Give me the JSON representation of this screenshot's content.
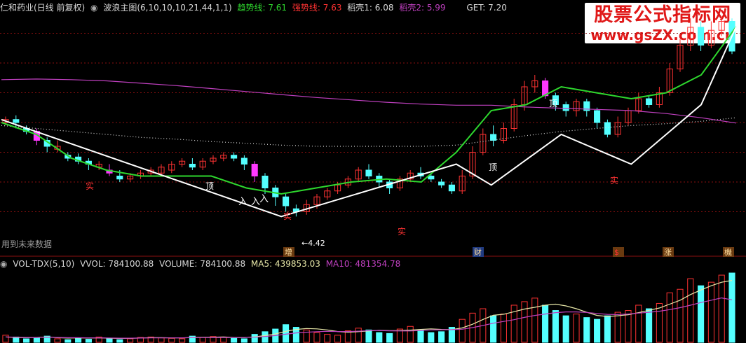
{
  "header": {
    "stock_title": "仁和药业(日线 前复权)",
    "indicator_title": "波浪主图(6,10,10,10,21,44,1,1)",
    "trend_line": "趋势线: 7.61",
    "strong_line": "强势线: 7.63",
    "rice_husk_1": "稻壳1: 6.08",
    "rice_husk_2": "稻壳2: 5.99",
    "get_value": "GET: 7.20"
  },
  "volume_header": {
    "indicator": "VOL-TDX(5,10)",
    "vvol": "VVOL: 784100.88",
    "volume": "VOLUME: 784100.88",
    "ma5": "MA5: 439853.03",
    "ma10": "MA10: 481354.78"
  },
  "watermark": {
    "title": "股票公式指标网",
    "url": "www.gsZX.com.cn"
  },
  "note": "用到未来数据",
  "annotations": {
    "ding": "顶",
    "shi": "实",
    "ru": "入",
    "low_price": "4.42"
  },
  "event_badges": [
    "增",
    "财",
    "$",
    "涨",
    "機"
  ],
  "colors": {
    "up": "#ff3232",
    "down": "#54ffff",
    "trend": "#2ed82e",
    "strong": "#ff3232",
    "husk1": "#d9d9d9",
    "husk2": "#c040c0",
    "wave": "#ffffff",
    "grid": "#8b1010",
    "ma5": "#e8e8a8",
    "ma10": "#c040c0",
    "highlight": "#ff38ff",
    "badge_bg": "#6a3a10",
    "badge_blue_bg": "#203a80"
  },
  "chart_data": [
    {
      "type": "candlestick",
      "title": "波浪主图(6,10,10,10,21,44,1,1)",
      "ylim": [
        4.0,
        7.8
      ],
      "grid": true,
      "series": [
        {
          "name": "趋势线",
          "values": [
            6.0,
            5.8,
            5.4,
            5.2,
            5.1,
            5.1,
            5.1,
            4.9,
            4.8,
            4.9,
            5.0,
            5.05,
            5.0,
            5.5,
            6.2,
            6.3,
            6.6,
            6.5,
            6.4,
            6.5,
            6.8,
            7.61
          ]
        },
        {
          "name": "稻壳1",
          "values": [
            5.95,
            5.9,
            5.85,
            5.8,
            5.75,
            5.72,
            5.68,
            5.65,
            5.62,
            5.6,
            5.6,
            5.6,
            5.6,
            5.62,
            5.7,
            5.78,
            5.85,
            5.9,
            5.95,
            5.98,
            6.02,
            6.08
          ]
        },
        {
          "name": "稻壳2",
          "values": [
            6.72,
            6.73,
            6.72,
            6.7,
            6.66,
            6.62,
            6.57,
            6.52,
            6.47,
            6.42,
            6.38,
            6.34,
            6.31,
            6.29,
            6.29,
            6.26,
            6.24,
            6.22,
            6.2,
            6.15,
            6.08,
            5.99
          ]
        },
        {
          "name": "波浪",
          "points": [
            [
              0,
              6.05
            ],
            [
              8,
              4.42
            ],
            [
              13,
              5.3
            ],
            [
              14,
              4.95
            ],
            [
              16,
              5.8
            ],
            [
              18,
              5.3
            ],
            [
              20,
              6.3
            ],
            [
              21,
              7.61
            ]
          ]
        }
      ],
      "candles": [
        [
          6.0,
          6.05,
          6.1,
          5.95
        ],
        [
          6.05,
          6.0,
          6.12,
          5.9
        ],
        [
          5.9,
          5.85,
          5.95,
          5.8
        ],
        [
          5.85,
          5.7,
          5.9,
          5.62
        ],
        [
          5.7,
          5.6,
          5.75,
          5.5
        ],
        [
          5.55,
          5.6,
          5.7,
          5.5
        ],
        [
          5.45,
          5.4,
          5.5,
          5.35
        ],
        [
          5.42,
          5.35,
          5.48,
          5.3
        ],
        [
          5.35,
          5.3,
          5.4,
          5.2
        ],
        [
          5.25,
          5.3,
          5.35,
          5.2
        ],
        [
          5.2,
          5.15,
          5.3,
          5.1
        ],
        [
          5.1,
          5.05,
          5.2,
          5.0
        ],
        [
          5.05,
          5.1,
          5.15,
          5.0
        ],
        [
          5.1,
          5.15,
          5.2,
          5.05
        ],
        [
          5.15,
          5.2,
          5.25,
          5.1
        ],
        [
          5.15,
          5.25,
          5.3,
          5.1
        ],
        [
          5.2,
          5.3,
          5.35,
          5.15
        ],
        [
          5.3,
          5.35,
          5.4,
          5.25
        ],
        [
          5.3,
          5.25,
          5.4,
          5.2
        ],
        [
          5.25,
          5.35,
          5.4,
          5.2
        ],
        [
          5.35,
          5.4,
          5.45,
          5.3
        ],
        [
          5.4,
          5.45,
          5.5,
          5.35
        ],
        [
          5.45,
          5.4,
          5.5,
          5.35
        ],
        [
          5.4,
          5.3,
          5.45,
          5.2
        ],
        [
          5.3,
          5.1,
          5.35,
          5.0
        ],
        [
          5.1,
          4.9,
          5.15,
          4.8
        ],
        [
          4.9,
          4.75,
          4.95,
          4.6
        ],
        [
          4.75,
          4.6,
          4.8,
          4.5
        ],
        [
          4.55,
          4.5,
          4.62,
          4.42
        ],
        [
          4.5,
          4.62,
          4.7,
          4.45
        ],
        [
          4.62,
          4.75,
          4.8,
          4.55
        ],
        [
          4.75,
          4.85,
          4.9,
          4.7
        ],
        [
          4.85,
          4.95,
          5.0,
          4.8
        ],
        [
          4.95,
          5.05,
          5.1,
          4.9
        ],
        [
          5.05,
          5.2,
          5.25,
          5.0
        ],
        [
          5.2,
          5.1,
          5.3,
          5.05
        ],
        [
          5.1,
          5.0,
          5.15,
          4.9
        ],
        [
          5.0,
          4.9,
          5.05,
          4.8
        ],
        [
          4.9,
          5.05,
          5.1,
          4.85
        ],
        [
          5.05,
          5.15,
          5.2,
          5.0
        ],
        [
          5.15,
          5.1,
          5.25,
          5.05
        ],
        [
          5.1,
          5.05,
          5.15,
          5.0
        ],
        [
          5.0,
          4.95,
          5.05,
          4.9
        ],
        [
          4.95,
          4.85,
          5.0,
          4.8
        ],
        [
          4.85,
          5.1,
          5.2,
          4.8
        ],
        [
          5.1,
          5.5,
          5.6,
          5.05
        ],
        [
          5.5,
          5.8,
          5.9,
          5.45
        ],
        [
          5.8,
          5.7,
          5.95,
          5.6
        ],
        [
          5.7,
          5.9,
          6.0,
          5.65
        ],
        [
          5.9,
          6.3,
          6.4,
          5.85
        ],
        [
          6.3,
          6.6,
          6.7,
          6.2
        ],
        [
          6.6,
          6.7,
          6.8,
          6.5
        ],
        [
          6.7,
          6.45,
          6.75,
          6.4
        ],
        [
          6.45,
          6.3,
          6.5,
          6.2
        ],
        [
          6.3,
          6.2,
          6.35,
          6.1
        ],
        [
          6.2,
          6.35,
          6.4,
          6.1
        ],
        [
          6.35,
          6.2,
          6.4,
          6.1
        ],
        [
          6.2,
          6.0,
          6.25,
          5.9
        ],
        [
          6.0,
          5.8,
          6.05,
          5.75
        ],
        [
          5.8,
          6.0,
          6.1,
          5.75
        ],
        [
          6.0,
          6.2,
          6.25,
          5.95
        ],
        [
          6.2,
          6.4,
          6.5,
          6.15
        ],
        [
          6.4,
          6.3,
          6.45,
          6.25
        ],
        [
          6.3,
          6.5,
          6.6,
          6.25
        ],
        [
          6.5,
          6.9,
          7.0,
          6.45
        ],
        [
          6.9,
          7.3,
          7.4,
          6.85
        ],
        [
          7.3,
          7.6,
          7.75,
          7.2
        ],
        [
          7.6,
          7.3,
          7.7,
          7.2
        ],
        [
          7.3,
          7.55,
          7.7,
          7.25
        ],
        [
          7.55,
          7.7,
          7.78,
          7.45
        ],
        [
          7.7,
          7.2,
          7.75,
          7.15
        ]
      ]
    },
    {
      "type": "bar",
      "title": "VOL-TDX(5,10)",
      "series": [
        {
          "name": "VVOL",
          "values": [
            80,
            60,
            40,
            55,
            70,
            40,
            30,
            50,
            35,
            60,
            45,
            30,
            40,
            55,
            60,
            50,
            45,
            40,
            70,
            55,
            65,
            60,
            45,
            40,
            90,
            120,
            150,
            200,
            170,
            140,
            110,
            90,
            80,
            130,
            160,
            140,
            110,
            100,
            150,
            180,
            140,
            110,
            120,
            170,
            260,
            330,
            380,
            300,
            320,
            420,
            460,
            500,
            420,
            360,
            300,
            320,
            280,
            260,
            300,
            340,
            360,
            420,
            380,
            440,
            560,
            600,
            720,
            640,
            680,
            760,
            784
          ]
        },
        {
          "name": "MA5",
          "values": [
            60,
            55,
            52,
            55,
            60,
            52,
            48,
            50,
            48,
            50,
            46,
            44,
            45,
            48,
            52,
            52,
            50,
            50,
            55,
            56,
            58,
            60,
            55,
            53,
            62,
            76,
            94,
            124,
            146,
            156,
            152,
            140,
            122,
            114,
            120,
            128,
            136,
            132,
            132,
            138,
            146,
            152,
            146,
            144,
            162,
            204,
            258,
            306,
            318,
            346,
            376,
            396,
            420,
            432,
            412,
            380,
            340,
            304,
            292,
            300,
            312,
            336,
            362,
            388,
            432,
            476,
            540,
            592,
            640,
            680,
            700
          ]
        },
        {
          "name": "MA10",
          "values": [
            60,
            58,
            55,
            55,
            58,
            55,
            52,
            52,
            50,
            51,
            49,
            47,
            47,
            48,
            50,
            50,
            50,
            51,
            53,
            54,
            55,
            55,
            54,
            54,
            58,
            66,
            76,
            92,
            106,
            114,
            120,
            124,
            122,
            122,
            126,
            132,
            134,
            130,
            128,
            128,
            134,
            140,
            142,
            143,
            148,
            166,
            190,
            216,
            236,
            256,
            282,
            304,
            320,
            336,
            344,
            344,
            338,
            326,
            316,
            314,
            320,
            330,
            340,
            352,
            370,
            392,
            420,
            450,
            476,
            502,
            481
          ]
        }
      ]
    }
  ]
}
